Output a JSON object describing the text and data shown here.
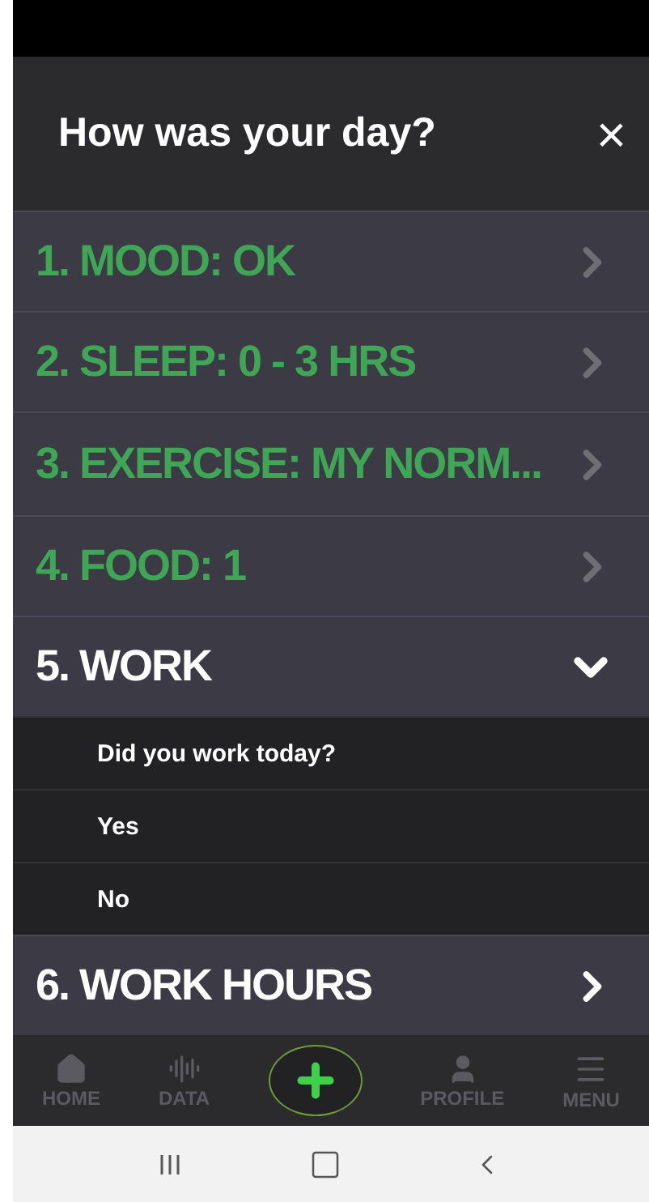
{
  "header": {
    "title": "How was your day?",
    "close": "×"
  },
  "questions": [
    {
      "label": "1. MOOD: OK",
      "answered": true,
      "expanded": false
    },
    {
      "label": "2. SLEEP: 0 - 3 HRS",
      "answered": true,
      "expanded": false
    },
    {
      "label": "3. EXERCISE: MY NORM...",
      "answered": true,
      "expanded": false
    },
    {
      "label": "4. FOOD: 1",
      "answered": true,
      "expanded": false
    },
    {
      "label": "5. WORK",
      "answered": false,
      "expanded": true,
      "prompt": "Did you work today?",
      "options": [
        {
          "label": "Yes",
          "selected": false
        },
        {
          "label": "No",
          "selected": false
        }
      ]
    },
    {
      "label": "6. WORK HOURS",
      "answered": false,
      "expanded": false
    }
  ],
  "nav": [
    {
      "kind": "home",
      "label": "HOME"
    },
    {
      "kind": "data",
      "label": "DATA"
    },
    {
      "kind": "add"
    },
    {
      "kind": "profile",
      "label": "PROFILE"
    },
    {
      "kind": "menu",
      "label": "MENU"
    }
  ]
}
